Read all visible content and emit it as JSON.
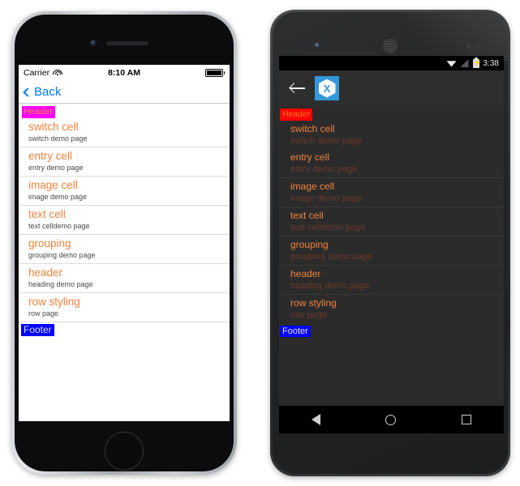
{
  "iphone": {
    "status_bar": {
      "carrier": "Carrier",
      "wifi_icon": "wifi-icon",
      "time": "8:10 AM",
      "battery_icon": "battery-full-icon"
    },
    "nav": {
      "back_label": "Back",
      "back_icon": "chevron-left-icon"
    },
    "list": {
      "section_header": "Header",
      "section_footer": "Footer",
      "rows": [
        {
          "title": "switch cell",
          "detail": "switch demo page"
        },
        {
          "title": "entry cell",
          "detail": "entry demo page"
        },
        {
          "title": "image cell",
          "detail": "image demo page"
        },
        {
          "title": "text cell",
          "detail": "text celldemo page"
        },
        {
          "title": "grouping",
          "detail": "grouping demo page"
        },
        {
          "title": "header",
          "detail": "heading demo page"
        },
        {
          "title": "row styling",
          "detail": "row page"
        }
      ]
    },
    "hardware": {
      "camera_icon": "front-camera-icon",
      "speaker_icon": "earpiece-speaker-icon",
      "home_button_icon": "home-button-icon"
    }
  },
  "android": {
    "status_bar": {
      "wifi_icon": "wifi-icon",
      "signal_icon": "signal-off-icon",
      "battery_icon": "battery-charging-icon",
      "time": "3:38"
    },
    "action_bar": {
      "back_icon": "arrow-back-icon",
      "app_logo": "xamarin-logo-icon",
      "app_logo_letter": "X"
    },
    "list": {
      "section_header": "Header",
      "section_footer": "Footer",
      "rows": [
        {
          "title": "switch cell",
          "detail": "switch demo page"
        },
        {
          "title": "entry cell",
          "detail": "entry demo page"
        },
        {
          "title": "image cell",
          "detail": "image demo page"
        },
        {
          "title": "text cell",
          "detail": "text celldemo page"
        },
        {
          "title": "grouping",
          "detail": "grouping demo page"
        },
        {
          "title": "header",
          "detail": "heading demo page"
        },
        {
          "title": "row styling",
          "detail": "row page"
        }
      ]
    },
    "nav_bar": {
      "back_icon": "nav-back-triangle-icon",
      "home_icon": "nav-home-circle-icon",
      "recents_icon": "nav-recents-square-icon"
    },
    "hardware": {
      "camera_icon": "front-camera-icon",
      "speaker_icon": "earpiece-speaker-icon",
      "sensor_icon": "proximity-sensor-icon"
    }
  },
  "colors": {
    "accent_orange": "#f1823d",
    "ios_blue": "#007aff",
    "header_bg_ios": "#ff00ff",
    "header_bg_android": "#ff0000",
    "footer_bg": "#0000ff",
    "xamarin_blue": "#3498db"
  }
}
